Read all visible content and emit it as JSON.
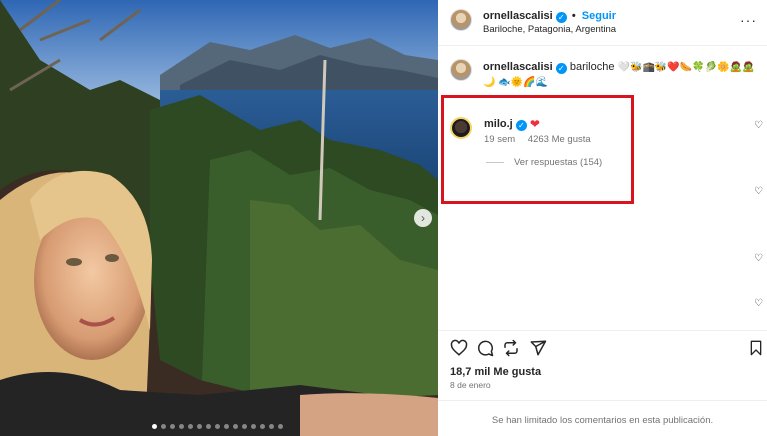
{
  "post": {
    "username": "ornellascalisi",
    "follow_label": "Seguir",
    "location": "Bariloche, Patagonia, Argentina",
    "more_icon": "more-icon"
  },
  "caption": {
    "username": "ornellascalisi",
    "text": "bariloche",
    "emojis": "🤍🐝🕋🐝❤️🌭🍀🥬🌼🧟🧟🌙 🐟🌞🌈🌊"
  },
  "comment": {
    "username": "milo.j",
    "time": "19 sem",
    "likes": "4263 Me gusta",
    "view_replies": "Ver respuestas (154)",
    "emoji": "❤"
  },
  "actions": {
    "likes_total": "18,7 mil Me gusta",
    "date": "8 de enero",
    "comments_limited": "Se han limitado los comentarios en esta publicación."
  },
  "carousel": {
    "dot_count": 15,
    "active_index": 0
  },
  "colors": {
    "accent": "#0095f6",
    "highlight_border": "#d8141f",
    "like_red": "#ed2f3f"
  }
}
